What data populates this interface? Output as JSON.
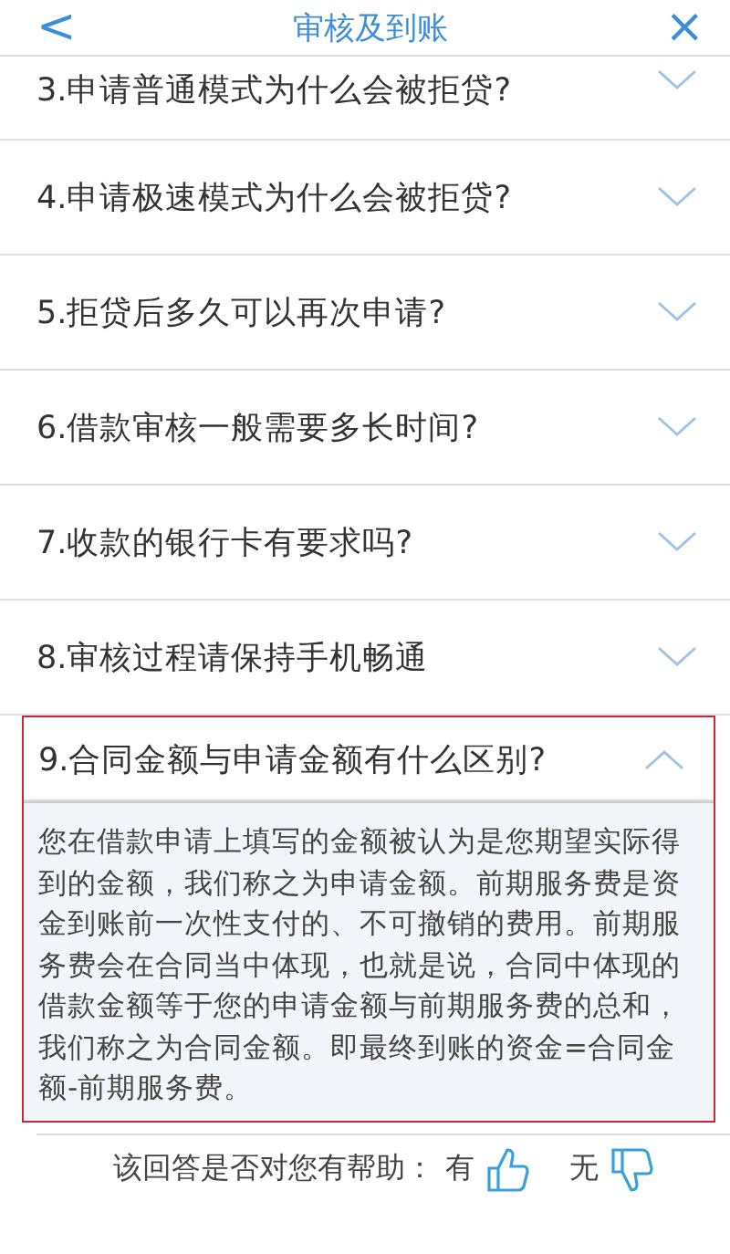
{
  "header": {
    "back": "<",
    "title": "审核及到账",
    "close": "×"
  },
  "questions": [
    {
      "text": "3.申请普通模式为什么会被拒贷?",
      "expanded": false
    },
    {
      "text": "4.申请极速模式为什么会被拒贷?",
      "expanded": false
    },
    {
      "text": "5.拒贷后多久可以再次申请?",
      "expanded": false
    },
    {
      "text": "6.借款审核一般需要多长时间?",
      "expanded": false
    },
    {
      "text": "7.收款的银行卡有要求吗?",
      "expanded": false
    },
    {
      "text": "8.审核过程请保持手机畅通",
      "expanded": false
    },
    {
      "text": "9.合同金额与申请金额有什么区别?",
      "expanded": true,
      "answer": "您在借款申请上填写的金额被认为是您期望实际得到的金额，我们称之为申请金额。前期服务费是资金到账前一次性支付的、不可撤销的费用。前期服务费会在合同当中体现，也就是说，合同中体现的借款金额等于您的申请金额与前期服务费的总和，我们称之为合同金额。即最终到账的资金=合同金额-前期服务费。"
    }
  ],
  "feedback": {
    "label": "该回答是否对您有帮助：",
    "yes": "有",
    "no": "无"
  }
}
